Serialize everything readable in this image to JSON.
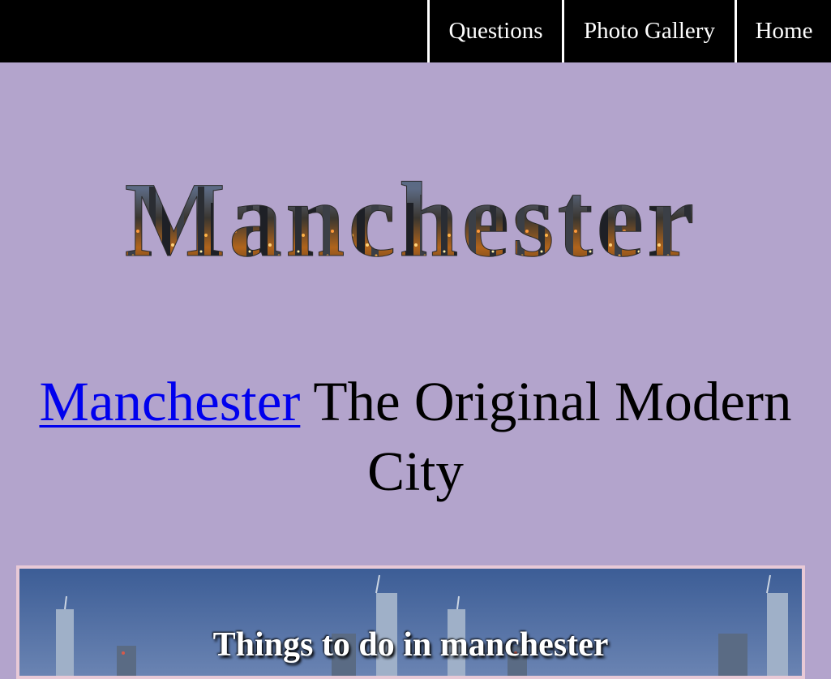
{
  "nav": {
    "items": [
      {
        "label": "Questions"
      },
      {
        "label": "Photo Gallery"
      },
      {
        "label": "Home"
      }
    ]
  },
  "hero": {
    "title": "Manchester"
  },
  "tagline": {
    "link_text": "Manchester",
    "rest_text": " The Original Modern City"
  },
  "banner": {
    "title": "Things to do in manchester"
  },
  "colors": {
    "page_background": "#b3a4cc",
    "nav_background": "#000000",
    "link": "#0000ee",
    "banner_border": "#e8c9d6"
  }
}
